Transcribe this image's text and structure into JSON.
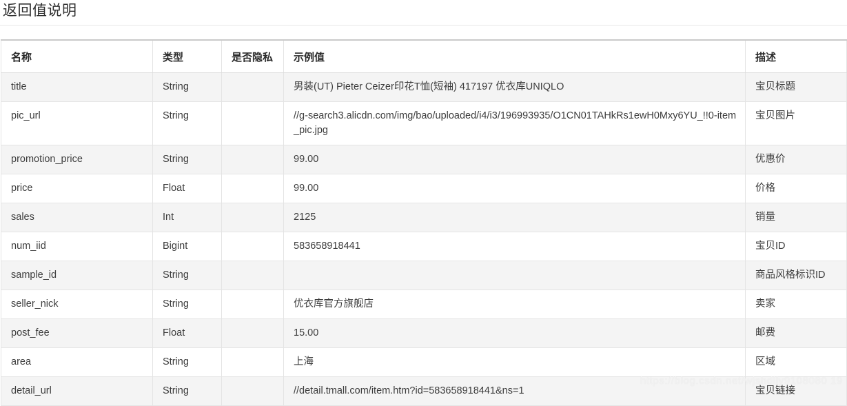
{
  "page": {
    "title": "返回值说明",
    "watermark": "https://blog.csdn.net/wjshdlly9108080 19"
  },
  "table": {
    "columns": [
      {
        "key": "name",
        "label": "名称"
      },
      {
        "key": "type",
        "label": "类型"
      },
      {
        "key": "is_private",
        "label": "是否隐私"
      },
      {
        "key": "example",
        "label": "示例值"
      },
      {
        "key": "description",
        "label": "描述"
      }
    ],
    "rows": [
      {
        "name": "title",
        "type": "String",
        "is_private": "",
        "example": "男装(UT) Pieter Ceizer印花T恤(短袖) 417197 优衣库UNIQLO",
        "description": "宝贝标题"
      },
      {
        "name": "pic_url",
        "type": "String",
        "is_private": "",
        "example": "//g-search3.alicdn.com/img/bao/uploaded/i4/i3/196993935/O1CN01TAHkRs1ewH0Mxy6YU_!!0-item_pic.jpg",
        "description": "宝贝图片"
      },
      {
        "name": "promotion_price",
        "type": "String",
        "is_private": "",
        "example": "99.00",
        "description": "优惠价"
      },
      {
        "name": "price",
        "type": "Float",
        "is_private": "",
        "example": "99.00",
        "description": "价格"
      },
      {
        "name": "sales",
        "type": "Int",
        "is_private": "",
        "example": "2125",
        "description": "销量"
      },
      {
        "name": "num_iid",
        "type": "Bigint",
        "is_private": "",
        "example": "583658918441",
        "description": "宝贝ID"
      },
      {
        "name": "sample_id",
        "type": "String",
        "is_private": "",
        "example": "",
        "description": "商品风格标识ID"
      },
      {
        "name": "seller_nick",
        "type": "String",
        "is_private": "",
        "example": "优衣库官方旗舰店",
        "description": "卖家"
      },
      {
        "name": "post_fee",
        "type": "Float",
        "is_private": "",
        "example": "15.00",
        "description": "邮费"
      },
      {
        "name": "area",
        "type": "String",
        "is_private": "",
        "example": "上海",
        "description": "区域"
      },
      {
        "name": "detail_url",
        "type": "String",
        "is_private": "",
        "example": "//detail.tmall.com/item.htm?id=583658918441&ns=1",
        "description": "宝贝链接"
      }
    ]
  }
}
